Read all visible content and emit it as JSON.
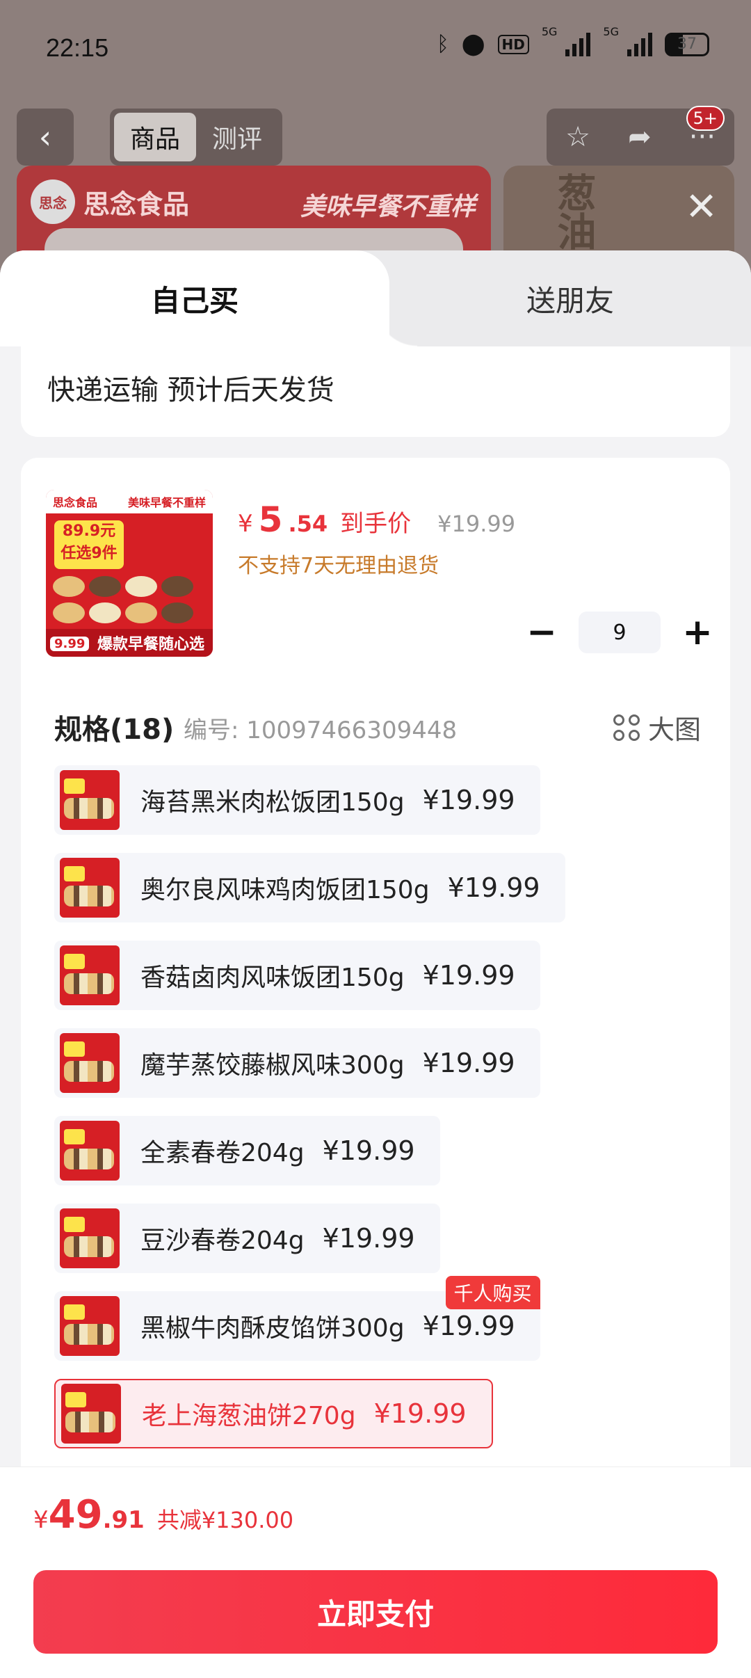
{
  "status_bar": {
    "time": "22:15",
    "hd_label": "HD",
    "signal1_label": "5G",
    "signal2_label": "5G",
    "battery": "37"
  },
  "top_nav": {
    "back_icon": "chevron-left-icon",
    "tabs": [
      "商品",
      "测评"
    ],
    "active_tab": "商品",
    "badge": "5+"
  },
  "banner": {
    "brand_logo": "思念",
    "brand_name": "思念食品",
    "slogan": "美味早餐不重样",
    "side_text": "葱油"
  },
  "sheet": {
    "tabs": {
      "self": "自己买",
      "friend": "送朋友"
    },
    "shipping_text": "快递运输 预计后天发货",
    "product": {
      "thumb": {
        "brand": "思念食品",
        "slogan": "美味早餐不重样",
        "promo_line1": "89.9元",
        "promo_line2": "任选9件",
        "footer": "爆款早餐随心选",
        "price_tag": "9.99"
      },
      "price_currency": "¥",
      "price_int": "5",
      "price_dec": ".54",
      "price_label": "到手价",
      "original_price": "¥19.99",
      "return_policy": "不支持7天无理由退货"
    },
    "quantity": {
      "minus": "−",
      "value": "9",
      "plus": "+"
    },
    "spec": {
      "title": "规格(18)",
      "code": "编号: 10097466309448",
      "big_image_label": "大图",
      "items": [
        {
          "name": "海苔黑米肉松饭团150g",
          "price": "¥19.99"
        },
        {
          "name": "奥尔良风味鸡肉饭团150g",
          "price": "¥19.99"
        },
        {
          "name": "香菇卤肉风味饭团150g",
          "price": "¥19.99"
        },
        {
          "name": "魔芋蒸饺藤椒风味300g",
          "price": "¥19.99"
        },
        {
          "name": "全素春卷204g",
          "price": "¥19.99"
        },
        {
          "name": "豆沙春卷204g",
          "price": "¥19.99"
        },
        {
          "name": "黑椒牛肉酥皮馅饼300g",
          "price": "¥19.99",
          "tag": "千人购买"
        },
        {
          "name": "老上海葱油饼270g",
          "price": "¥19.99",
          "selected": true
        }
      ]
    }
  },
  "bottom": {
    "total_currency": "¥",
    "total_int": "49",
    "total_dec": ".91",
    "saving": "共减¥130.00",
    "pay_button": "立即支付"
  },
  "colors": {
    "accent": "#e8333b",
    "warning": "#c77a2a",
    "pay_button": "#fe2a3a"
  }
}
